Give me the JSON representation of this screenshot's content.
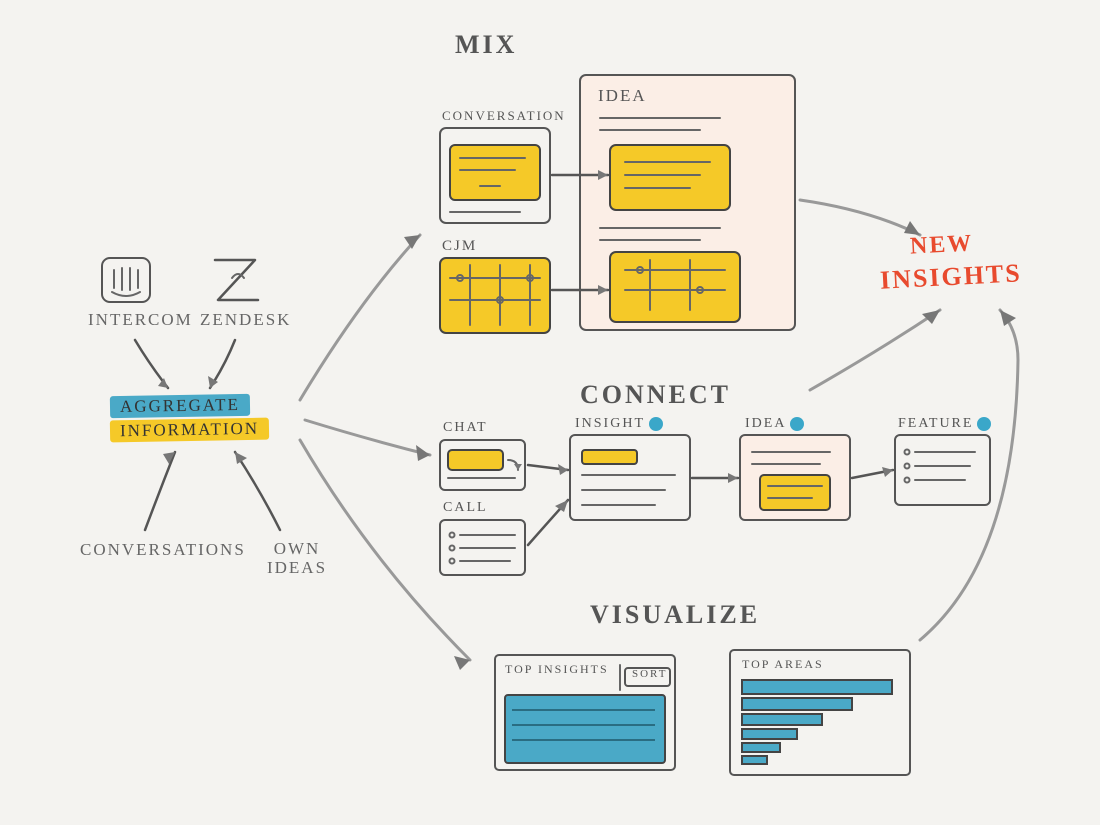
{
  "colors": {
    "yellow": "#f5c928",
    "blue": "#4aa9c7",
    "ink": "#555555",
    "accent": "#e84a2e",
    "pink": "#fbeee6",
    "bg": "#f4f3f0"
  },
  "sources": {
    "intercom": "INTERCOM",
    "zendesk": "ZENDESK",
    "conversations": "CONVERSATIONS",
    "own_ideas": "OWN IDEAS"
  },
  "center": {
    "line1": "AGGREGATE",
    "line2": "INFORMATION"
  },
  "sections": {
    "mix": "MIX",
    "connect": "CONNECT",
    "visualize": "VISUALIZE"
  },
  "mix": {
    "conversation": "CONVERSATION",
    "cjm": "CJM",
    "idea": "IDEA"
  },
  "connect": {
    "chat": "CHAT",
    "call": "CALL",
    "insight": "INSIGHT",
    "idea": "IDEA",
    "feature": "FEATURE"
  },
  "visualize": {
    "top_insights": "TOP INSIGHTS",
    "sort": "SORT",
    "top_areas": "TOP AREAS"
  },
  "output": {
    "new": "NEW",
    "insights": "INSIGHTS"
  }
}
